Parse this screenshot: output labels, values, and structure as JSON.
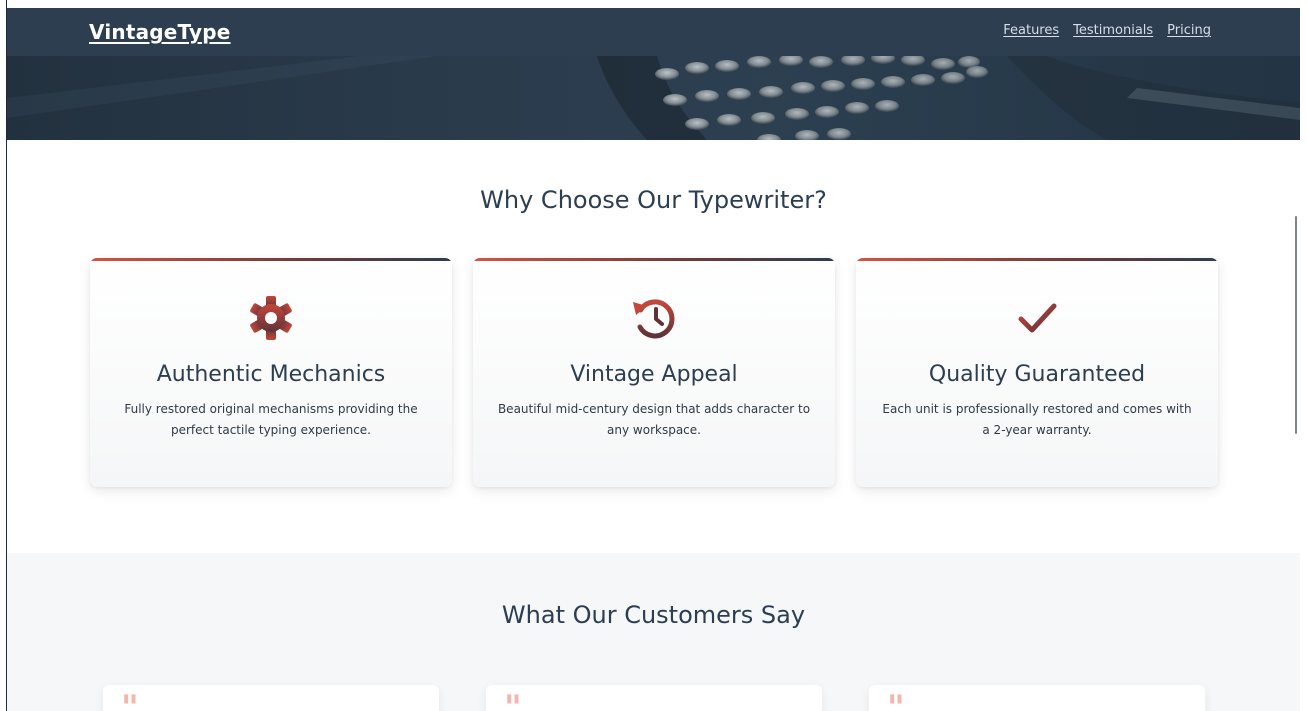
{
  "navbar": {
    "brand": "VintageType",
    "links": [
      {
        "label": "Features"
      },
      {
        "label": "Testimonials"
      },
      {
        "label": "Pricing"
      }
    ]
  },
  "features": {
    "title": "Why Choose Our Typewriter?",
    "cards": [
      {
        "icon": "gear-icon",
        "title": "Authentic Mechanics",
        "description": "Fully restored original mechanisms providing the perfect tactile typing experience."
      },
      {
        "icon": "history-icon",
        "title": "Vintage Appeal",
        "description": "Beautiful mid-century design that adds character to any workspace."
      },
      {
        "icon": "checkmark-icon",
        "title": "Quality Guaranteed",
        "description": "Each unit is professionally restored and comes with a 2-year warranty."
      }
    ]
  },
  "testimonials": {
    "title": "What Our Customers Say",
    "quote_icon": "quote-icon"
  },
  "colors": {
    "navbar": "#2c3e50",
    "accent": "#d25442",
    "icon": "#7a3a3a",
    "quote": "#f2b7ac",
    "testimonials_bg": "#f6f7f9"
  }
}
